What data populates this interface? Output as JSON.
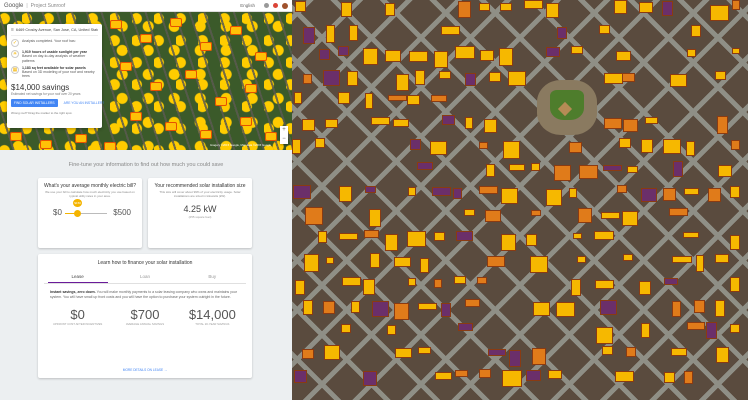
{
  "header": {
    "brand": "Google",
    "product": "Project Sunroof",
    "language": "English"
  },
  "info_card": {
    "address": "6469 Crosby Avenue, San Jose, CA, United States",
    "rows": [
      {
        "text": "Analysis completed. Your roof has:"
      },
      {
        "bold": "1,919 hours of usable sunlight per year",
        "text": "Based on day-to-day analysis of weather patterns"
      },
      {
        "bold": "1,183 sq feet available for solar panels",
        "text": "Based on 3D modeling of your roof and nearby trees"
      }
    ],
    "savings_title": "$14,000 savings",
    "savings_sub": "Estimated net savings for your roof over 20 years",
    "find_button": "FIND SOLAR INSTALLERS",
    "installer_button": "ARE YOU AN INSTALLER?",
    "wrong_link": "Wrong roof? Drag the marker to the right spot."
  },
  "map": {
    "zoom_in": "+",
    "zoom_out": "−",
    "credit": "Imagery ©2015 Google, Map data ©2015 Google"
  },
  "finetune": "Fine-tune your information to find out how much you could save",
  "bill_card": {
    "title": "What's your average monthly electric bill?",
    "desc": "We use your bill to calculate how much electricity you use based on typical utility rates in your area.",
    "min_label": "$0",
    "max_label": "$500",
    "value_label": "$150",
    "value_fraction": 0.3
  },
  "size_card": {
    "title": "Your recommended solar installation size",
    "desc": "This size will cover about 99% of your electricity usage. Solar installations are sized in kilowatts (kW).",
    "value": "4.25 kW",
    "sub": "(255 square feet)"
  },
  "finance_card": {
    "title": "Learn how to finance your solar installation",
    "tabs": [
      "Lease",
      "Loan",
      "Buy"
    ],
    "active_tab": 0,
    "desc_bold": "Instant savings, zero down.",
    "desc": "You will make monthly payments to a solar leasing company who owns and maintains your system. You will have small up front costs and you will have the option to purchase your system outright in the future.",
    "stats": [
      {
        "value": "$0",
        "label": "UPFRONT COST AFTER INCENTIVES"
      },
      {
        "value": "$700",
        "label": "AVERAGE ANNUAL SAVINGS"
      },
      {
        "value": "$14,000",
        "label": "TOTAL 20-YEAR SAVINGS"
      }
    ],
    "link": "MORE DETAILS ON LEASE →"
  },
  "colors": {
    "primary_blue": "#4285f4",
    "solar_yellow": "#f4b400",
    "tab_accent": "#6a1b9a"
  }
}
